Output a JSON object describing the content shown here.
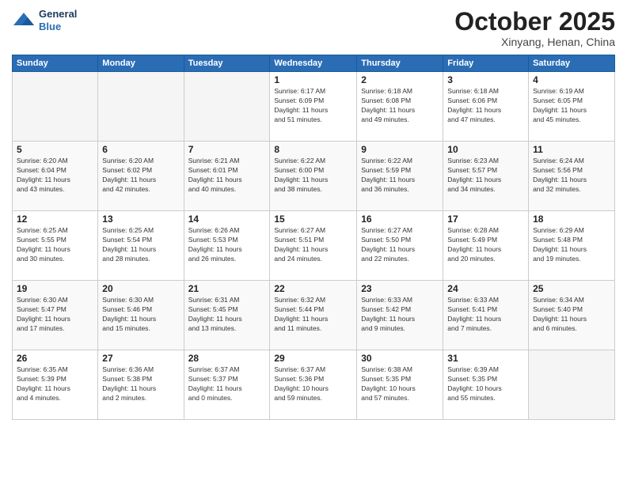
{
  "logo": {
    "line1": "General",
    "line2": "Blue"
  },
  "title": "October 2025",
  "subtitle": "Xinyang, Henan, China",
  "days_of_week": [
    "Sunday",
    "Monday",
    "Tuesday",
    "Wednesday",
    "Thursday",
    "Friday",
    "Saturday"
  ],
  "weeks": [
    [
      {
        "day": "",
        "info": ""
      },
      {
        "day": "",
        "info": ""
      },
      {
        "day": "",
        "info": ""
      },
      {
        "day": "1",
        "info": "Sunrise: 6:17 AM\nSunset: 6:09 PM\nDaylight: 11 hours\nand 51 minutes."
      },
      {
        "day": "2",
        "info": "Sunrise: 6:18 AM\nSunset: 6:08 PM\nDaylight: 11 hours\nand 49 minutes."
      },
      {
        "day": "3",
        "info": "Sunrise: 6:18 AM\nSunset: 6:06 PM\nDaylight: 11 hours\nand 47 minutes."
      },
      {
        "day": "4",
        "info": "Sunrise: 6:19 AM\nSunset: 6:05 PM\nDaylight: 11 hours\nand 45 minutes."
      }
    ],
    [
      {
        "day": "5",
        "info": "Sunrise: 6:20 AM\nSunset: 6:04 PM\nDaylight: 11 hours\nand 43 minutes."
      },
      {
        "day": "6",
        "info": "Sunrise: 6:20 AM\nSunset: 6:02 PM\nDaylight: 11 hours\nand 42 minutes."
      },
      {
        "day": "7",
        "info": "Sunrise: 6:21 AM\nSunset: 6:01 PM\nDaylight: 11 hours\nand 40 minutes."
      },
      {
        "day": "8",
        "info": "Sunrise: 6:22 AM\nSunset: 6:00 PM\nDaylight: 11 hours\nand 38 minutes."
      },
      {
        "day": "9",
        "info": "Sunrise: 6:22 AM\nSunset: 5:59 PM\nDaylight: 11 hours\nand 36 minutes."
      },
      {
        "day": "10",
        "info": "Sunrise: 6:23 AM\nSunset: 5:57 PM\nDaylight: 11 hours\nand 34 minutes."
      },
      {
        "day": "11",
        "info": "Sunrise: 6:24 AM\nSunset: 5:56 PM\nDaylight: 11 hours\nand 32 minutes."
      }
    ],
    [
      {
        "day": "12",
        "info": "Sunrise: 6:25 AM\nSunset: 5:55 PM\nDaylight: 11 hours\nand 30 minutes."
      },
      {
        "day": "13",
        "info": "Sunrise: 6:25 AM\nSunset: 5:54 PM\nDaylight: 11 hours\nand 28 minutes."
      },
      {
        "day": "14",
        "info": "Sunrise: 6:26 AM\nSunset: 5:53 PM\nDaylight: 11 hours\nand 26 minutes."
      },
      {
        "day": "15",
        "info": "Sunrise: 6:27 AM\nSunset: 5:51 PM\nDaylight: 11 hours\nand 24 minutes."
      },
      {
        "day": "16",
        "info": "Sunrise: 6:27 AM\nSunset: 5:50 PM\nDaylight: 11 hours\nand 22 minutes."
      },
      {
        "day": "17",
        "info": "Sunrise: 6:28 AM\nSunset: 5:49 PM\nDaylight: 11 hours\nand 20 minutes."
      },
      {
        "day": "18",
        "info": "Sunrise: 6:29 AM\nSunset: 5:48 PM\nDaylight: 11 hours\nand 19 minutes."
      }
    ],
    [
      {
        "day": "19",
        "info": "Sunrise: 6:30 AM\nSunset: 5:47 PM\nDaylight: 11 hours\nand 17 minutes."
      },
      {
        "day": "20",
        "info": "Sunrise: 6:30 AM\nSunset: 5:46 PM\nDaylight: 11 hours\nand 15 minutes."
      },
      {
        "day": "21",
        "info": "Sunrise: 6:31 AM\nSunset: 5:45 PM\nDaylight: 11 hours\nand 13 minutes."
      },
      {
        "day": "22",
        "info": "Sunrise: 6:32 AM\nSunset: 5:44 PM\nDaylight: 11 hours\nand 11 minutes."
      },
      {
        "day": "23",
        "info": "Sunrise: 6:33 AM\nSunset: 5:42 PM\nDaylight: 11 hours\nand 9 minutes."
      },
      {
        "day": "24",
        "info": "Sunrise: 6:33 AM\nSunset: 5:41 PM\nDaylight: 11 hours\nand 7 minutes."
      },
      {
        "day": "25",
        "info": "Sunrise: 6:34 AM\nSunset: 5:40 PM\nDaylight: 11 hours\nand 6 minutes."
      }
    ],
    [
      {
        "day": "26",
        "info": "Sunrise: 6:35 AM\nSunset: 5:39 PM\nDaylight: 11 hours\nand 4 minutes."
      },
      {
        "day": "27",
        "info": "Sunrise: 6:36 AM\nSunset: 5:38 PM\nDaylight: 11 hours\nand 2 minutes."
      },
      {
        "day": "28",
        "info": "Sunrise: 6:37 AM\nSunset: 5:37 PM\nDaylight: 11 hours\nand 0 minutes."
      },
      {
        "day": "29",
        "info": "Sunrise: 6:37 AM\nSunset: 5:36 PM\nDaylight: 10 hours\nand 59 minutes."
      },
      {
        "day": "30",
        "info": "Sunrise: 6:38 AM\nSunset: 5:35 PM\nDaylight: 10 hours\nand 57 minutes."
      },
      {
        "day": "31",
        "info": "Sunrise: 6:39 AM\nSunset: 5:35 PM\nDaylight: 10 hours\nand 55 minutes."
      },
      {
        "day": "",
        "info": ""
      }
    ]
  ]
}
